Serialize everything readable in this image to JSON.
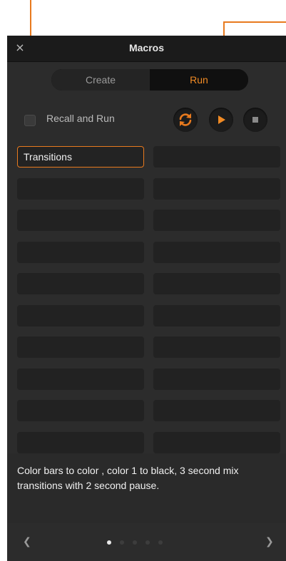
{
  "window": {
    "title": "Macros",
    "close_label": "×"
  },
  "tabs": [
    {
      "label": "Create",
      "active": false
    },
    {
      "label": "Run",
      "active": true
    }
  ],
  "recall": {
    "label": "Recall and Run",
    "checked": false
  },
  "controls": {
    "loop_icon": "loop-icon",
    "play_icon": "play-icon",
    "stop_icon": "stop-icon"
  },
  "macros": [
    {
      "label": "Transitions"
    },
    {
      "label": ""
    },
    {
      "label": ""
    },
    {
      "label": ""
    },
    {
      "label": ""
    },
    {
      "label": ""
    },
    {
      "label": ""
    },
    {
      "label": ""
    },
    {
      "label": ""
    },
    {
      "label": ""
    },
    {
      "label": ""
    },
    {
      "label": ""
    },
    {
      "label": ""
    },
    {
      "label": ""
    },
    {
      "label": ""
    },
    {
      "label": ""
    },
    {
      "label": ""
    },
    {
      "label": ""
    },
    {
      "label": ""
    },
    {
      "label": ""
    }
  ],
  "description": "Color bars to color , color 1 to black, 3 second mix transitions with 2 second pause.",
  "pager": {
    "page_count": 5,
    "current_page": 1,
    "prev_icon": "chevron-left-icon",
    "next_icon": "chevron-right-icon"
  },
  "colors": {
    "accent": "#e87a1e",
    "panel_bg": "#2c2c2c",
    "titlebar_bg": "#1b1b1b",
    "cell_bg": "#222222"
  }
}
